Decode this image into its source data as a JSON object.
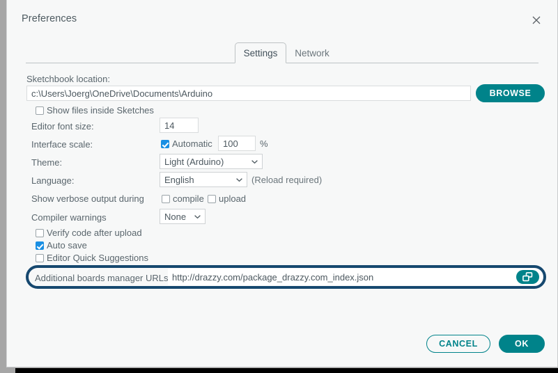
{
  "window": {
    "title": "Preferences",
    "close_icon": "close-icon"
  },
  "tabs": [
    {
      "label": "Settings",
      "active": true
    },
    {
      "label": "Network",
      "active": false
    }
  ],
  "settings": {
    "sketchbook": {
      "label": "Sketchbook location:",
      "value": "c:\\Users\\Joerg\\OneDrive\\Documents\\Arduino",
      "browse_label": "BROWSE"
    },
    "show_files_inside_sketches": {
      "label": "Show files inside Sketches",
      "checked": false
    },
    "editor_font_size": {
      "label": "Editor font size:",
      "value": "14"
    },
    "interface_scale": {
      "label": "Interface scale:",
      "automatic_label": "Automatic",
      "automatic_checked": true,
      "value": "100",
      "unit": "%"
    },
    "theme": {
      "label": "Theme:",
      "value": "Light (Arduino)"
    },
    "language": {
      "label": "Language:",
      "value": "English",
      "note": "(Reload required)"
    },
    "verbose_output": {
      "label": "Show verbose output during",
      "compile_label": "compile",
      "compile_checked": false,
      "upload_label": "upload",
      "upload_checked": false
    },
    "compiler_warnings": {
      "label": "Compiler warnings",
      "value": "None"
    },
    "verify_code": {
      "label": "Verify code after upload",
      "checked": false
    },
    "auto_save": {
      "label": "Auto save",
      "checked": true
    },
    "quick_suggestions": {
      "label": "Editor Quick Suggestions",
      "checked": false
    },
    "additional_urls": {
      "label": "Additional boards manager URLs:",
      "value": "http://drazzy.com/package_drazzy.com_index.json",
      "icon": "open-window-icon"
    }
  },
  "footer": {
    "cancel_label": "CANCEL",
    "ok_label": "OK"
  },
  "colors": {
    "accent_teal": "#00838a",
    "highlight_navy": "#16486f",
    "checkbox_blue": "#1a8fe3",
    "dialog_bg": "#f7f8f8"
  }
}
